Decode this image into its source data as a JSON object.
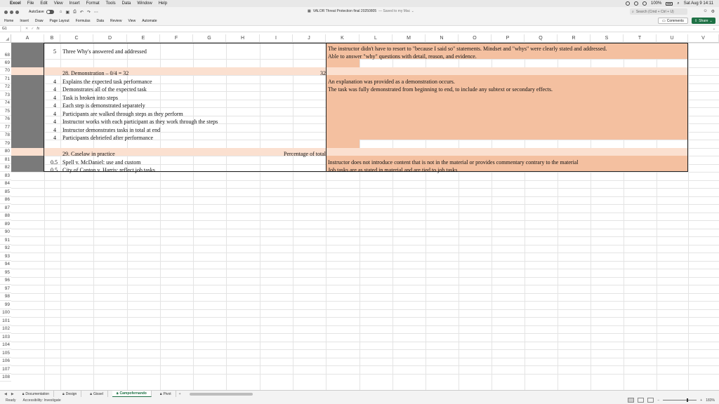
{
  "menubar": {
    "apple": "",
    "items": [
      "Excel",
      "File",
      "Edit",
      "View",
      "Insert",
      "Format",
      "Tools",
      "Data",
      "Window",
      "Help"
    ],
    "battery": "100%",
    "clock": "Sat Aug 9  14:11"
  },
  "titlebar": {
    "autosave_label": "AutoSave",
    "doc_title": "VALOR Threat Protection final 20250805",
    "saved_status": "— Saved to my Mac ⌄",
    "search_placeholder": "Search (Cmd + Ctrl + U)"
  },
  "ribbon": {
    "tabs": [
      "Home",
      "Insert",
      "Draw",
      "Page Layout",
      "Formulas",
      "Data",
      "Review",
      "View",
      "Automate"
    ],
    "comments_label": "Comments",
    "share_label": "Share"
  },
  "formula": {
    "name_box": "G1",
    "fx": "fx",
    "content": ""
  },
  "columns": [
    "A",
    "B",
    "C",
    "D",
    "E",
    "F",
    "G",
    "H",
    "I",
    "J",
    "K",
    "L",
    "M",
    "N",
    "O",
    "P",
    "Q",
    "R",
    "S",
    "T",
    "U",
    "V"
  ],
  "rows": [
    "68",
    "69",
    "70",
    "71",
    "72",
    "73",
    "74",
    "75",
    "76",
    "77",
    "78",
    "79",
    "80",
    "81",
    "82",
    "83",
    "84",
    "85",
    "86",
    "87",
    "88",
    "89",
    "90",
    "91",
    "92",
    "93",
    "94",
    "95",
    "96",
    "97",
    "98",
    "99",
    "100",
    "101",
    "102",
    "103",
    "104",
    "105",
    "106",
    "107",
    "108"
  ],
  "cells": {
    "r68_b": "5",
    "r68_c": "Three Why's answered and addressed",
    "r68_k1": "The instructor didn't have to resort to \"because I said so\" statements. Mindset and \"whys\" were clearly stated and addressed.",
    "r68_k2": "Able to answer \"why\" questions with detail, reason, and evidence.",
    "r70_c": "28.  Demonstration – 0/4 = 32",
    "r70_j": "32",
    "r71_b": "4",
    "r71_c": "Explains the expected task performance",
    "r71_k": "An explanation was provided as a demonstration occurs.",
    "r72_b": "4",
    "r72_c": "Demonstrates all of the expected task",
    "r72_k": "The task was fully demonstrated from beginning to end, to include any subtext or secondary effects.",
    "r73_b": "4",
    "r73_c": "Task is broken into steps",
    "r74_b": "4",
    "r74_c": "Each step is demonstrated separately",
    "r75_b": "4",
    "r75_c": "Participants are walked through steps as they perform",
    "r76_b": "4",
    "r76_c": "Instructor works with each participant as they work through the steps",
    "r77_b": "4",
    "r77_c": "Instructor demonstrates tasks in total at end",
    "r78_b": "4",
    "r78_c": "Participants debriefed after performance",
    "r80_c": "29. Caselaw in practice",
    "r80_i": "Percentage of total",
    "r81_b": "0.5",
    "r81_c": "Spell v. McDaniel: use and custom",
    "r81_k": "Instructor does not introduce content that is not in the material or provides commentary contrary to the material",
    "r82_b": "0.5",
    "r82_c": "City of Canton v. Harris: reflect job tasks",
    "r82_k": "Job tasks are as stated in material and are tied to job tasks"
  },
  "sheets": {
    "tabs": [
      "Documentation",
      "Design",
      "Gissel",
      "Campofernando",
      "Pivot"
    ],
    "active_index": 3,
    "add_label": "+"
  },
  "status": {
    "ready": "Ready",
    "accessibility": "Accessibility: Investigate",
    "zoom": "183%"
  },
  "colors": {
    "peach": "#f4c0a0",
    "light_peach": "#fbe0d0",
    "gray_col_a": "#7a7a7a",
    "accent_green": "#1e7145"
  }
}
